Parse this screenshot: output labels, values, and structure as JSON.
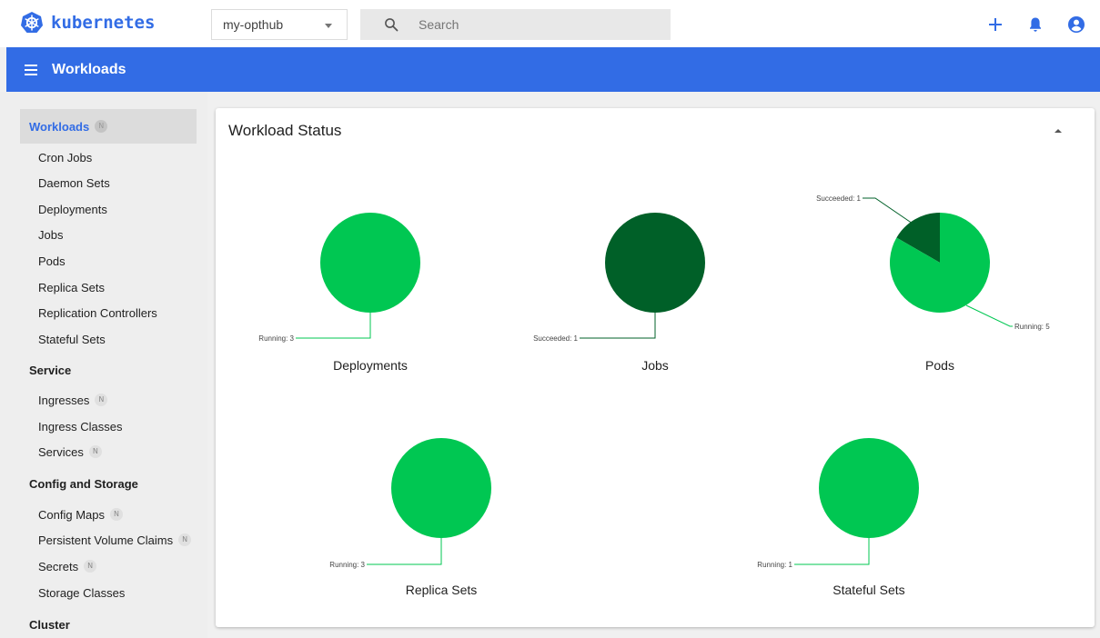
{
  "brand": {
    "name": "kubernetes"
  },
  "header": {
    "namespace": "my-opthub",
    "search_placeholder": "Search",
    "actions": [
      "create-icon",
      "notifications-icon",
      "account-icon"
    ]
  },
  "appbar": {
    "title": "Workloads"
  },
  "sidebar": {
    "active": {
      "label": "Workloads",
      "badge": "N"
    },
    "workload_items": [
      {
        "label": "Cron Jobs"
      },
      {
        "label": "Daemon Sets"
      },
      {
        "label": "Deployments"
      },
      {
        "label": "Jobs"
      },
      {
        "label": "Pods"
      },
      {
        "label": "Replica Sets"
      },
      {
        "label": "Replication Controllers"
      },
      {
        "label": "Stateful Sets"
      }
    ],
    "service": {
      "title": "Service",
      "items": [
        {
          "label": "Ingresses",
          "badge": "N"
        },
        {
          "label": "Ingress Classes"
        },
        {
          "label": "Services",
          "badge": "N"
        }
      ]
    },
    "config": {
      "title": "Config and Storage",
      "items": [
        {
          "label": "Config Maps",
          "badge": "N"
        },
        {
          "label": "Persistent Volume Claims",
          "badge": "N"
        },
        {
          "label": "Secrets",
          "badge": "N"
        },
        {
          "label": "Storage Classes"
        }
      ]
    },
    "cluster": {
      "title": "Cluster"
    }
  },
  "card": {
    "title": "Workload Status"
  },
  "colors": {
    "running": "#00c752",
    "succeeded": "#006028",
    "accent": "#326ce5"
  },
  "chart_data": [
    {
      "type": "pie",
      "title": "Deployments",
      "slices": [
        {
          "label": "Running",
          "value": 3,
          "text": "Running: 3"
        }
      ]
    },
    {
      "type": "pie",
      "title": "Jobs",
      "slices": [
        {
          "label": "Succeeded",
          "value": 1,
          "text": "Succeeded: 1"
        }
      ]
    },
    {
      "type": "pie",
      "title": "Pods",
      "slices": [
        {
          "label": "Running",
          "value": 5,
          "text": "Running: 5"
        },
        {
          "label": "Succeeded",
          "value": 1,
          "text": "Succeeded: 1"
        }
      ]
    },
    {
      "type": "pie",
      "title": "Replica Sets",
      "slices": [
        {
          "label": "Running",
          "value": 3,
          "text": "Running: 3"
        }
      ]
    },
    {
      "type": "pie",
      "title": "Stateful Sets",
      "slices": [
        {
          "label": "Running",
          "value": 1,
          "text": "Running: 1"
        }
      ]
    }
  ]
}
